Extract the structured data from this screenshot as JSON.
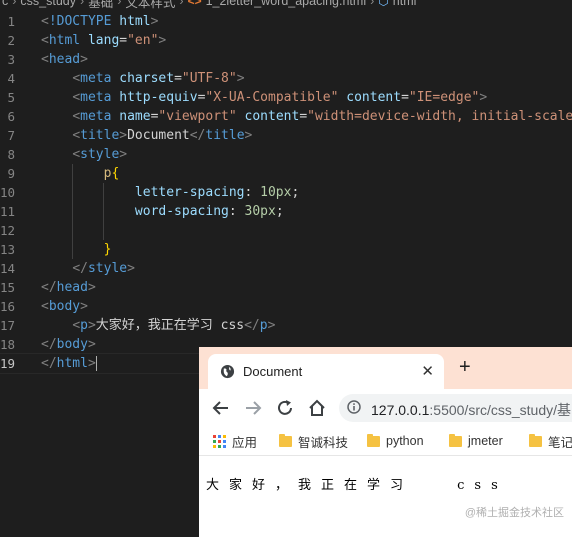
{
  "breadcrumb": [
    "c",
    "css_study",
    "基础",
    "文本样式",
    "1_2letter_word_apacing.html",
    "html"
  ],
  "editor": {
    "lines": [
      {
        "n": "1",
        "tokens": [
          [
            "t-punc",
            "<"
          ],
          [
            "t-tag",
            "!DOCTYPE"
          ],
          [
            "t-text",
            " "
          ],
          [
            "t-attr",
            "html"
          ],
          [
            "t-punc",
            ">"
          ]
        ]
      },
      {
        "n": "2",
        "tokens": [
          [
            "t-punc",
            "<"
          ],
          [
            "t-tag",
            "html"
          ],
          [
            "t-text",
            " "
          ],
          [
            "t-attr",
            "lang"
          ],
          [
            "t-text",
            "="
          ],
          [
            "t-str",
            "\"en\""
          ],
          [
            "t-punc",
            ">"
          ]
        ]
      },
      {
        "n": "3",
        "tokens": [
          [
            "t-punc",
            "<"
          ],
          [
            "t-tag",
            "head"
          ],
          [
            "t-punc",
            ">"
          ]
        ]
      },
      {
        "n": "4",
        "indent": "    ",
        "tokens": [
          [
            "t-punc",
            "<"
          ],
          [
            "t-tag",
            "meta"
          ],
          [
            "t-text",
            " "
          ],
          [
            "t-attr",
            "charset"
          ],
          [
            "t-text",
            "="
          ],
          [
            "t-str",
            "\"UTF-8\""
          ],
          [
            "t-punc",
            ">"
          ]
        ]
      },
      {
        "n": "5",
        "indent": "    ",
        "tokens": [
          [
            "t-punc",
            "<"
          ],
          [
            "t-tag",
            "meta"
          ],
          [
            "t-text",
            " "
          ],
          [
            "t-attr",
            "http-equiv"
          ],
          [
            "t-text",
            "="
          ],
          [
            "t-str",
            "\"X-UA-Compatible\""
          ],
          [
            "t-text",
            " "
          ],
          [
            "t-attr",
            "content"
          ],
          [
            "t-text",
            "="
          ],
          [
            "t-str",
            "\"IE=edge\""
          ],
          [
            "t-punc",
            ">"
          ]
        ]
      },
      {
        "n": "6",
        "indent": "    ",
        "tokens": [
          [
            "t-punc",
            "<"
          ],
          [
            "t-tag",
            "meta"
          ],
          [
            "t-text",
            " "
          ],
          [
            "t-attr",
            "name"
          ],
          [
            "t-text",
            "="
          ],
          [
            "t-str",
            "\"viewport\""
          ],
          [
            "t-text",
            " "
          ],
          [
            "t-attr",
            "content"
          ],
          [
            "t-text",
            "="
          ],
          [
            "t-str",
            "\"width=device-width, initial-scale="
          ]
        ]
      },
      {
        "n": "7",
        "indent": "    ",
        "tokens": [
          [
            "t-punc",
            "<"
          ],
          [
            "t-tag",
            "title"
          ],
          [
            "t-punc",
            ">"
          ],
          [
            "t-text",
            "Document"
          ],
          [
            "t-punc",
            "</"
          ],
          [
            "t-tag",
            "title"
          ],
          [
            "t-punc",
            ">"
          ]
        ]
      },
      {
        "n": "8",
        "indent": "    ",
        "tokens": [
          [
            "t-punc",
            "<"
          ],
          [
            "t-tag",
            "style"
          ],
          [
            "t-punc",
            ">"
          ]
        ]
      },
      {
        "n": "9",
        "indent": "        ",
        "tokens": [
          [
            "t-sel",
            "p"
          ],
          [
            "t-brace",
            "{"
          ]
        ]
      },
      {
        "n": "10",
        "indent": "            ",
        "tokens": [
          [
            "t-prop",
            "letter-spacing"
          ],
          [
            "t-text",
            ": "
          ],
          [
            "t-num",
            "10px"
          ],
          [
            "t-text",
            ";"
          ]
        ]
      },
      {
        "n": "11",
        "indent": "            ",
        "tokens": [
          [
            "t-prop",
            "word-spacing"
          ],
          [
            "t-text",
            ": "
          ],
          [
            "t-num",
            "30px"
          ],
          [
            "t-text",
            ";"
          ]
        ]
      },
      {
        "n": "12",
        "tokens": []
      },
      {
        "n": "13",
        "indent": "        ",
        "tokens": [
          [
            "t-brace",
            "}"
          ]
        ]
      },
      {
        "n": "14",
        "indent": "    ",
        "tokens": [
          [
            "t-punc",
            "</"
          ],
          [
            "t-tag",
            "style"
          ],
          [
            "t-punc",
            ">"
          ]
        ]
      },
      {
        "n": "15",
        "tokens": [
          [
            "t-punc",
            "</"
          ],
          [
            "t-tag",
            "head"
          ],
          [
            "t-punc",
            ">"
          ]
        ]
      },
      {
        "n": "16",
        "tokens": [
          [
            "t-punc",
            "<"
          ],
          [
            "t-tag",
            "body"
          ],
          [
            "t-punc",
            ">"
          ]
        ]
      },
      {
        "n": "17",
        "indent": "    ",
        "tokens": [
          [
            "t-punc",
            "<"
          ],
          [
            "t-tag",
            "p"
          ],
          [
            "t-punc",
            ">"
          ],
          [
            "t-text",
            "大家好，我正在学习 css"
          ],
          [
            "t-punc",
            "</"
          ],
          [
            "t-tag",
            "p"
          ],
          [
            "t-punc",
            ">"
          ]
        ]
      },
      {
        "n": "18",
        "tokens": [
          [
            "t-punc",
            "</"
          ],
          [
            "t-tag",
            "body"
          ],
          [
            "t-punc",
            ">"
          ]
        ]
      },
      {
        "n": "19",
        "tokens": [
          [
            "t-punc",
            "</"
          ],
          [
            "t-tag",
            "html"
          ],
          [
            "t-punc",
            ">"
          ]
        ],
        "current": true
      }
    ]
  },
  "browser": {
    "tab_title": "Document",
    "close_glyph": "✕",
    "newtab_glyph": "+",
    "url_host": "127.0.0.1",
    "url_rest": ":5500/src/css_study/基",
    "bookmarks": [
      "应用",
      "智诚科技",
      "python",
      "jmeter",
      "笔记"
    ],
    "page_text": "大家好，我正在学习 css"
  },
  "watermark": "@稀土掘金技术社区",
  "colors": {
    "editor_bg": "#1e1e1e",
    "tabstrip_bg": "#fde1d3",
    "folder": "#f5c242"
  }
}
